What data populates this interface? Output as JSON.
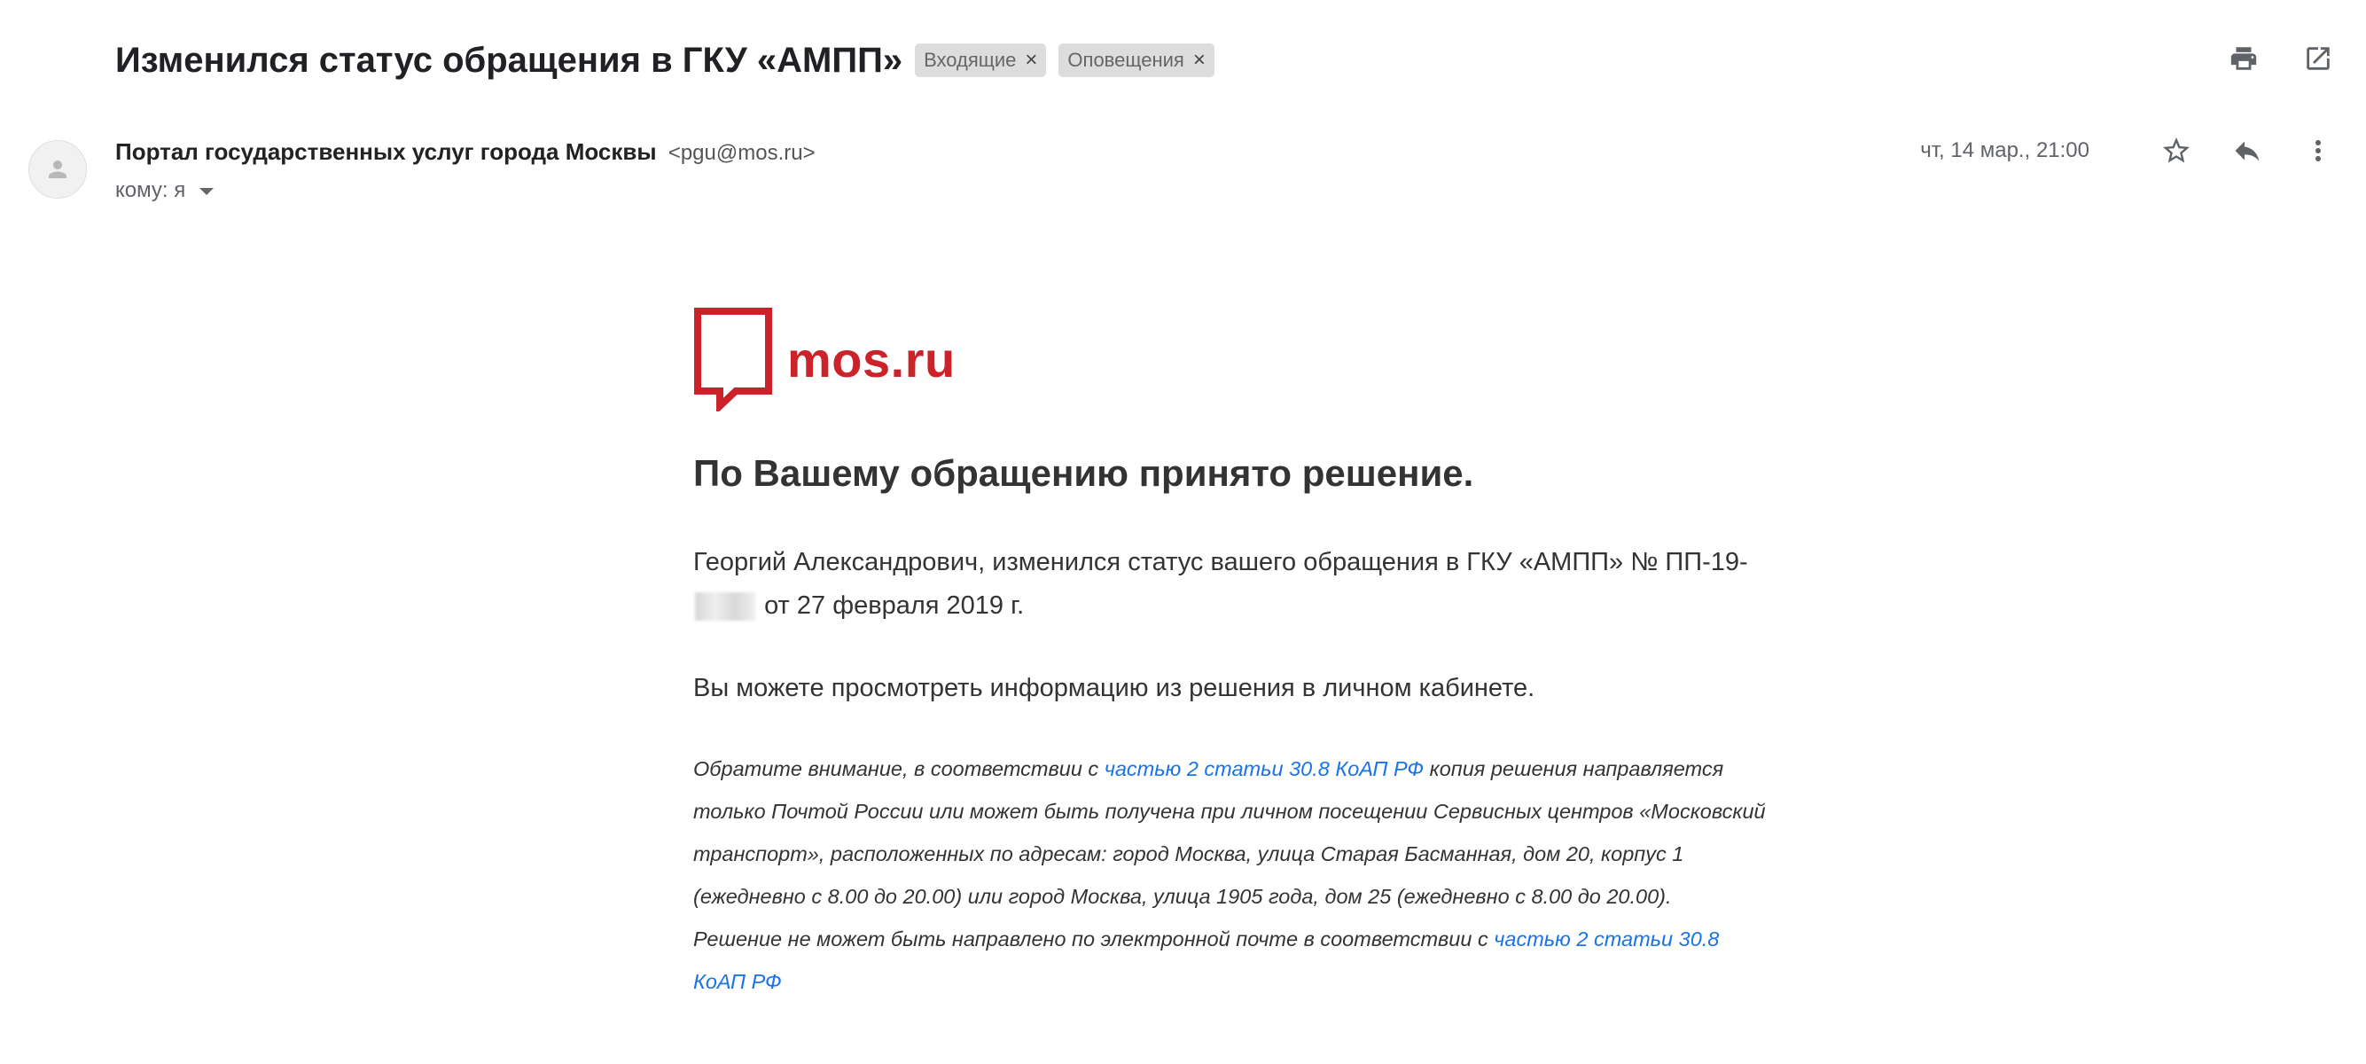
{
  "subject": "Изменился статус обращения в ГКУ «АМПП»",
  "labels": [
    {
      "text": "Входящие"
    },
    {
      "text": "Оповещения"
    }
  ],
  "sender": {
    "name": "Портал государственных услуг города Москвы",
    "email": "<pgu@mos.ru>",
    "to_label": "кому: я"
  },
  "date": "чт, 14 мар., 21:00",
  "icons": {
    "print": "printer-icon",
    "open_new_window": "open-in-new-window-icon",
    "star": "star-icon",
    "reply": "reply-icon",
    "more": "more-vertical-icon",
    "avatar": "person-avatar-icon",
    "logo": "mos-ru-speech-bubble-logo"
  },
  "colors": {
    "brand_red": "#cc2229",
    "link": "#1a73e8",
    "chip_bg": "#dddddd"
  },
  "body": {
    "logo_text": "mos.ru",
    "headline": "По Вашему обращению принято решение.",
    "status_prefix": "Георгий Александрович, изменился статус вашего обращения в ГКУ «АМПП» № ПП-19-",
    "status_suffix": "от 27 февраля 2019 г.",
    "info_line": "Вы можете просмотреть информацию из решения в личном кабинете.",
    "note_part1": "Обратите внимание, в соответствии с ",
    "note_link1": "частью 2 статьи 30.8 КоАП РФ",
    "note_part2": " копия решения направляется только Почтой России или может быть получена при личном посещении Сервисных центров «Московский транспорт», расположенных по адресам: город Москва, улица Старая Басманная, дом 20, корпус 1 (ежедневно с 8.00 до 20.00) или город Москва, улица 1905 года, дом 25 (ежедневно с 8.00 до 20.00). Решение не может быть направлено по электронной почте в соответствии с ",
    "note_link2": "частью 2 статьи 30.8 КоАП РФ"
  }
}
